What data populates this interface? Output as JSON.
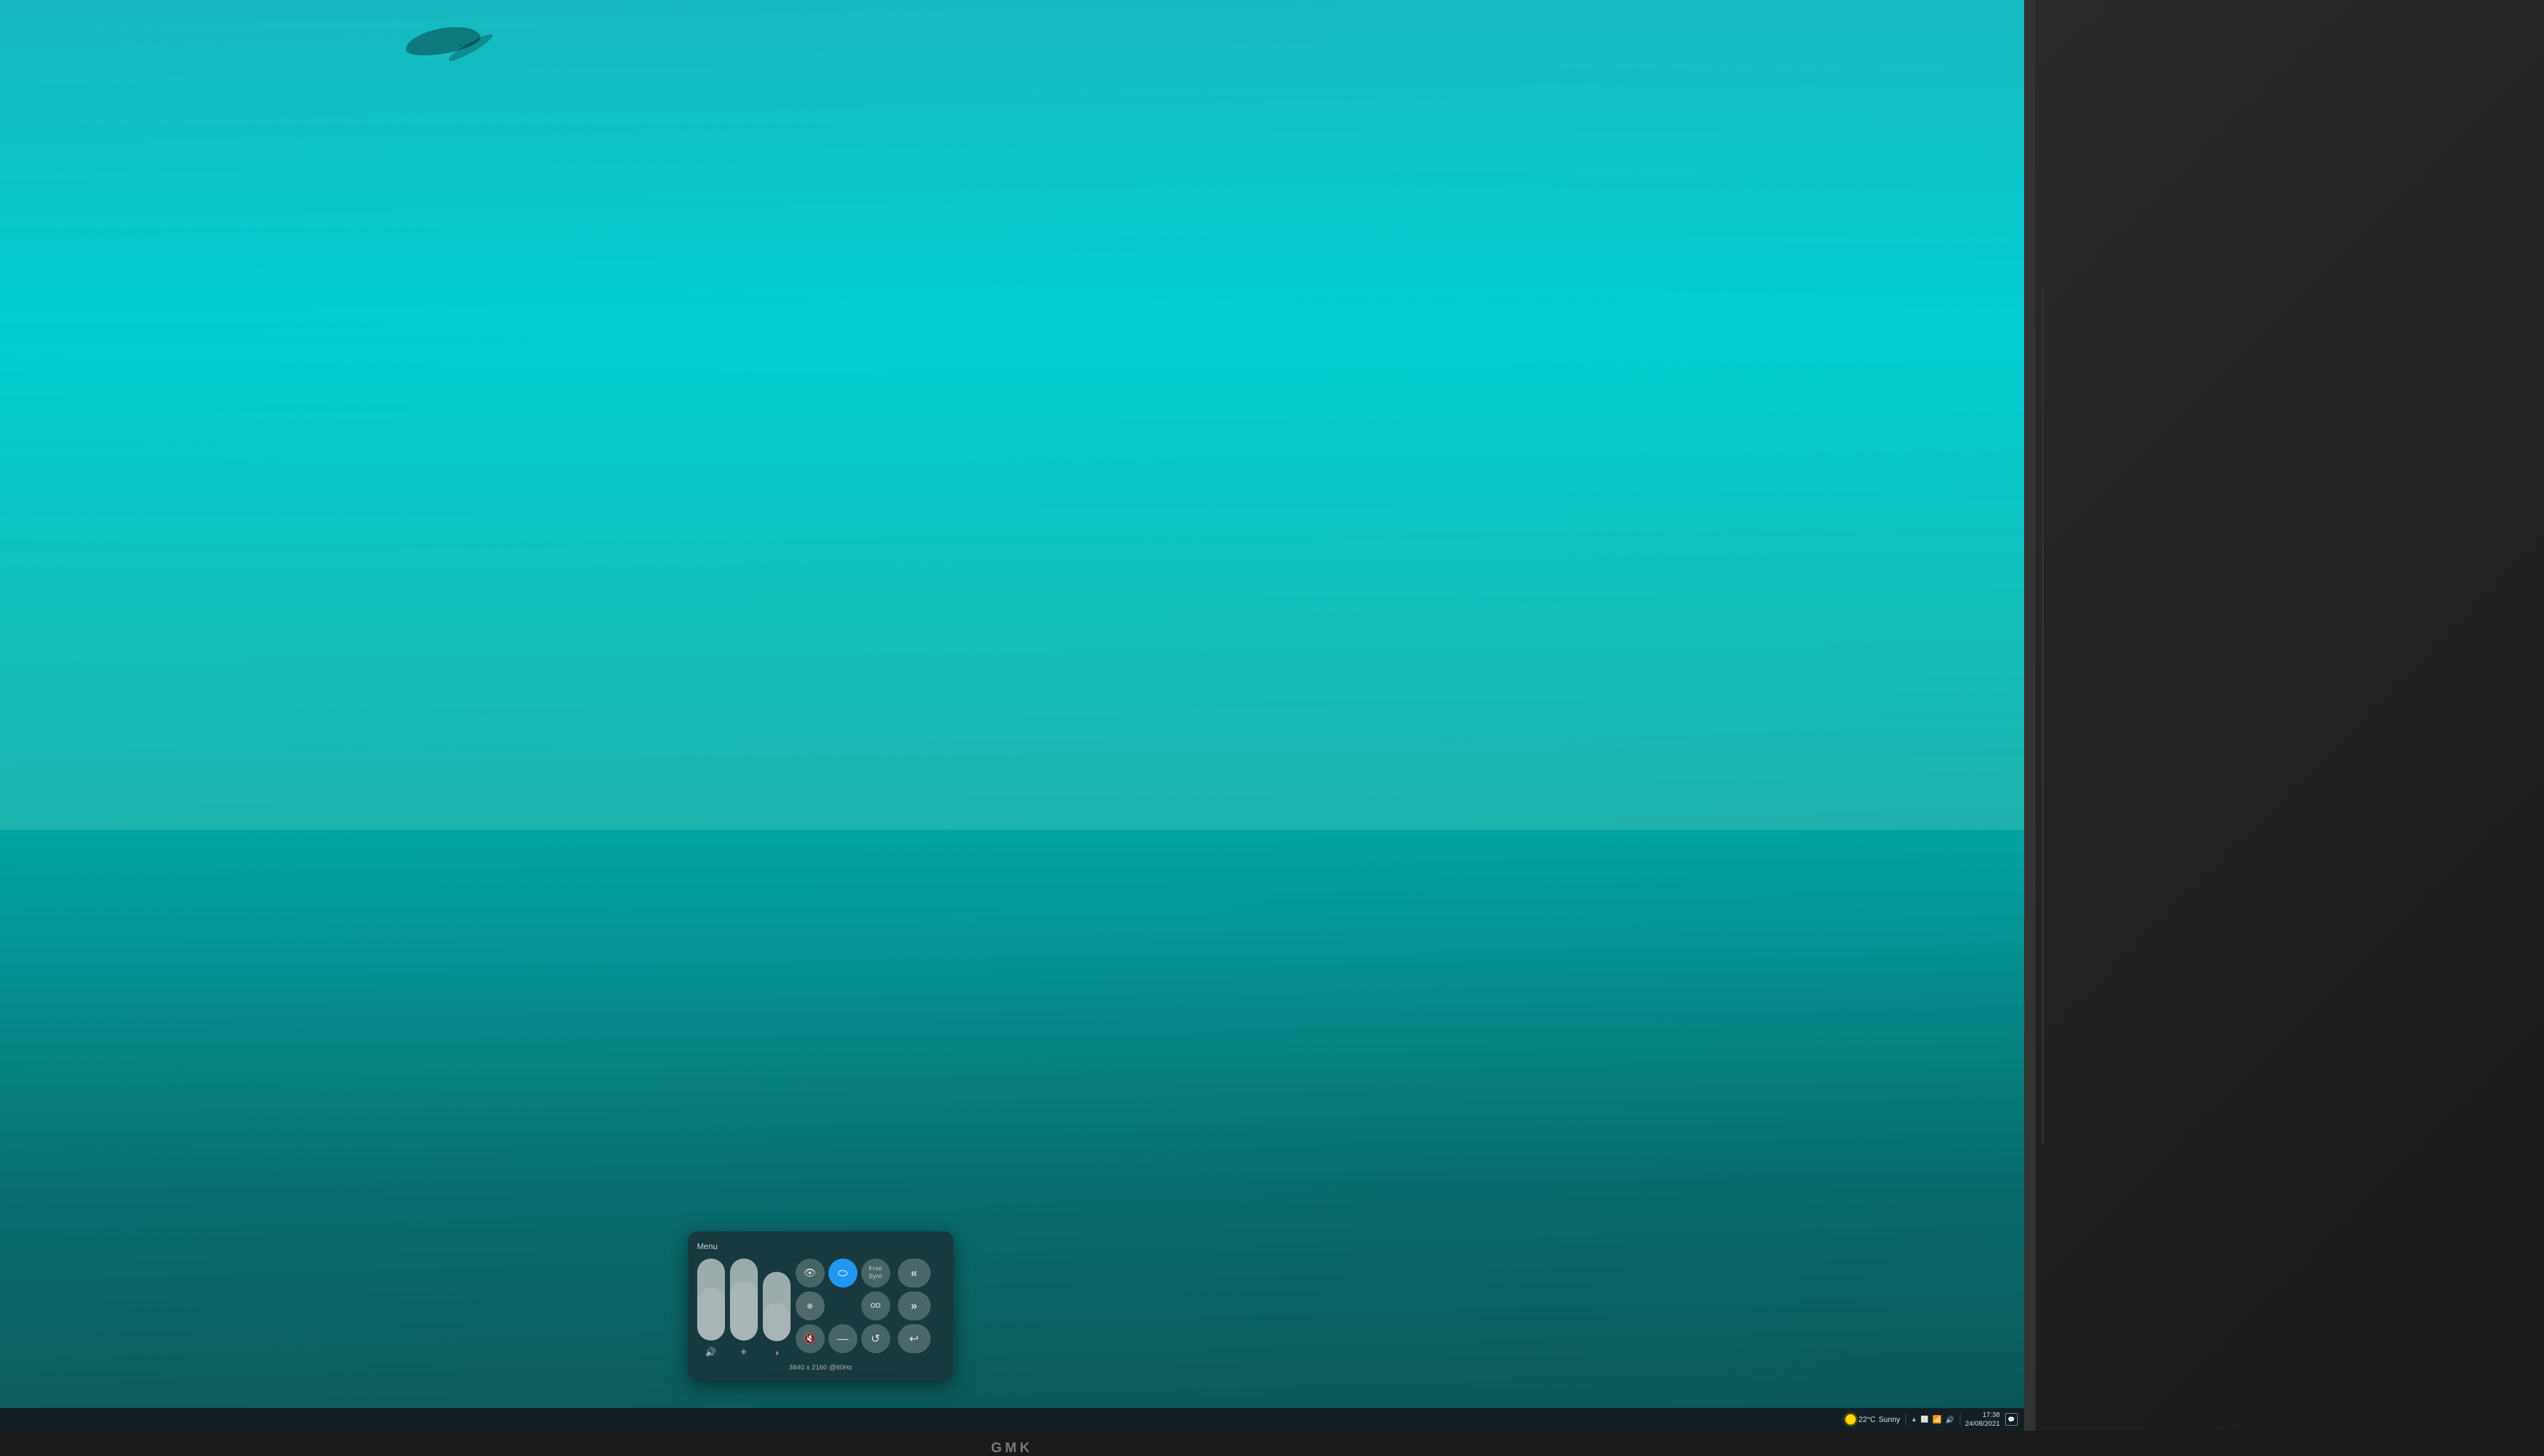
{
  "screen": {
    "background_color": "#00b5b8"
  },
  "osd": {
    "title": "Menu",
    "sliders": [
      {
        "id": "volume",
        "height_pct": 65,
        "icon": "🔊",
        "label": "volume-slider"
      },
      {
        "id": "brightness",
        "height_pct": 72,
        "icon": "☀",
        "label": "brightness-slider"
      },
      {
        "id": "contrast",
        "height_pct": 55,
        "icon": "◑",
        "label": "contrast-slider"
      }
    ],
    "controls": [
      {
        "id": "eye-care",
        "icon": "👁",
        "active": false,
        "label": "Eye Care"
      },
      {
        "id": "oval",
        "icon": "⬭",
        "active": true,
        "color": "blue",
        "label": "Input"
      },
      {
        "id": "free-sync",
        "text": "Free\nSync",
        "active": false,
        "label": "FreeSync"
      },
      {
        "id": "circle",
        "icon": "●",
        "active": false,
        "large": true,
        "label": "Select"
      },
      {
        "id": "empty",
        "icon": "",
        "active": false,
        "label": "OD",
        "text": "OD"
      },
      {
        "id": "mute",
        "icon": "🔇",
        "active": false,
        "label": "Mute"
      },
      {
        "id": "minus",
        "icon": "➖",
        "active": false,
        "label": "Minus"
      },
      {
        "id": "refresh",
        "icon": "↺",
        "active": false,
        "label": "Refresh"
      }
    ],
    "nav_buttons": [
      {
        "id": "back-fast",
        "icon": "«",
        "label": "Back Fast"
      },
      {
        "id": "forward-fast",
        "icon": "»",
        "label": "Forward Fast"
      },
      {
        "id": "return",
        "icon": "↩",
        "label": "Return"
      }
    ],
    "resolution_text": "3840 x 2160 @60Hz"
  },
  "taskbar": {
    "weather_icon": "☀",
    "temperature": "22°C",
    "condition": "Sunny",
    "time": "17:38",
    "date": "24/08/2021",
    "tray_icons": [
      "▲",
      "⬜",
      "📶",
      "🔊"
    ]
  },
  "monitor": {
    "brand": "GMK"
  }
}
